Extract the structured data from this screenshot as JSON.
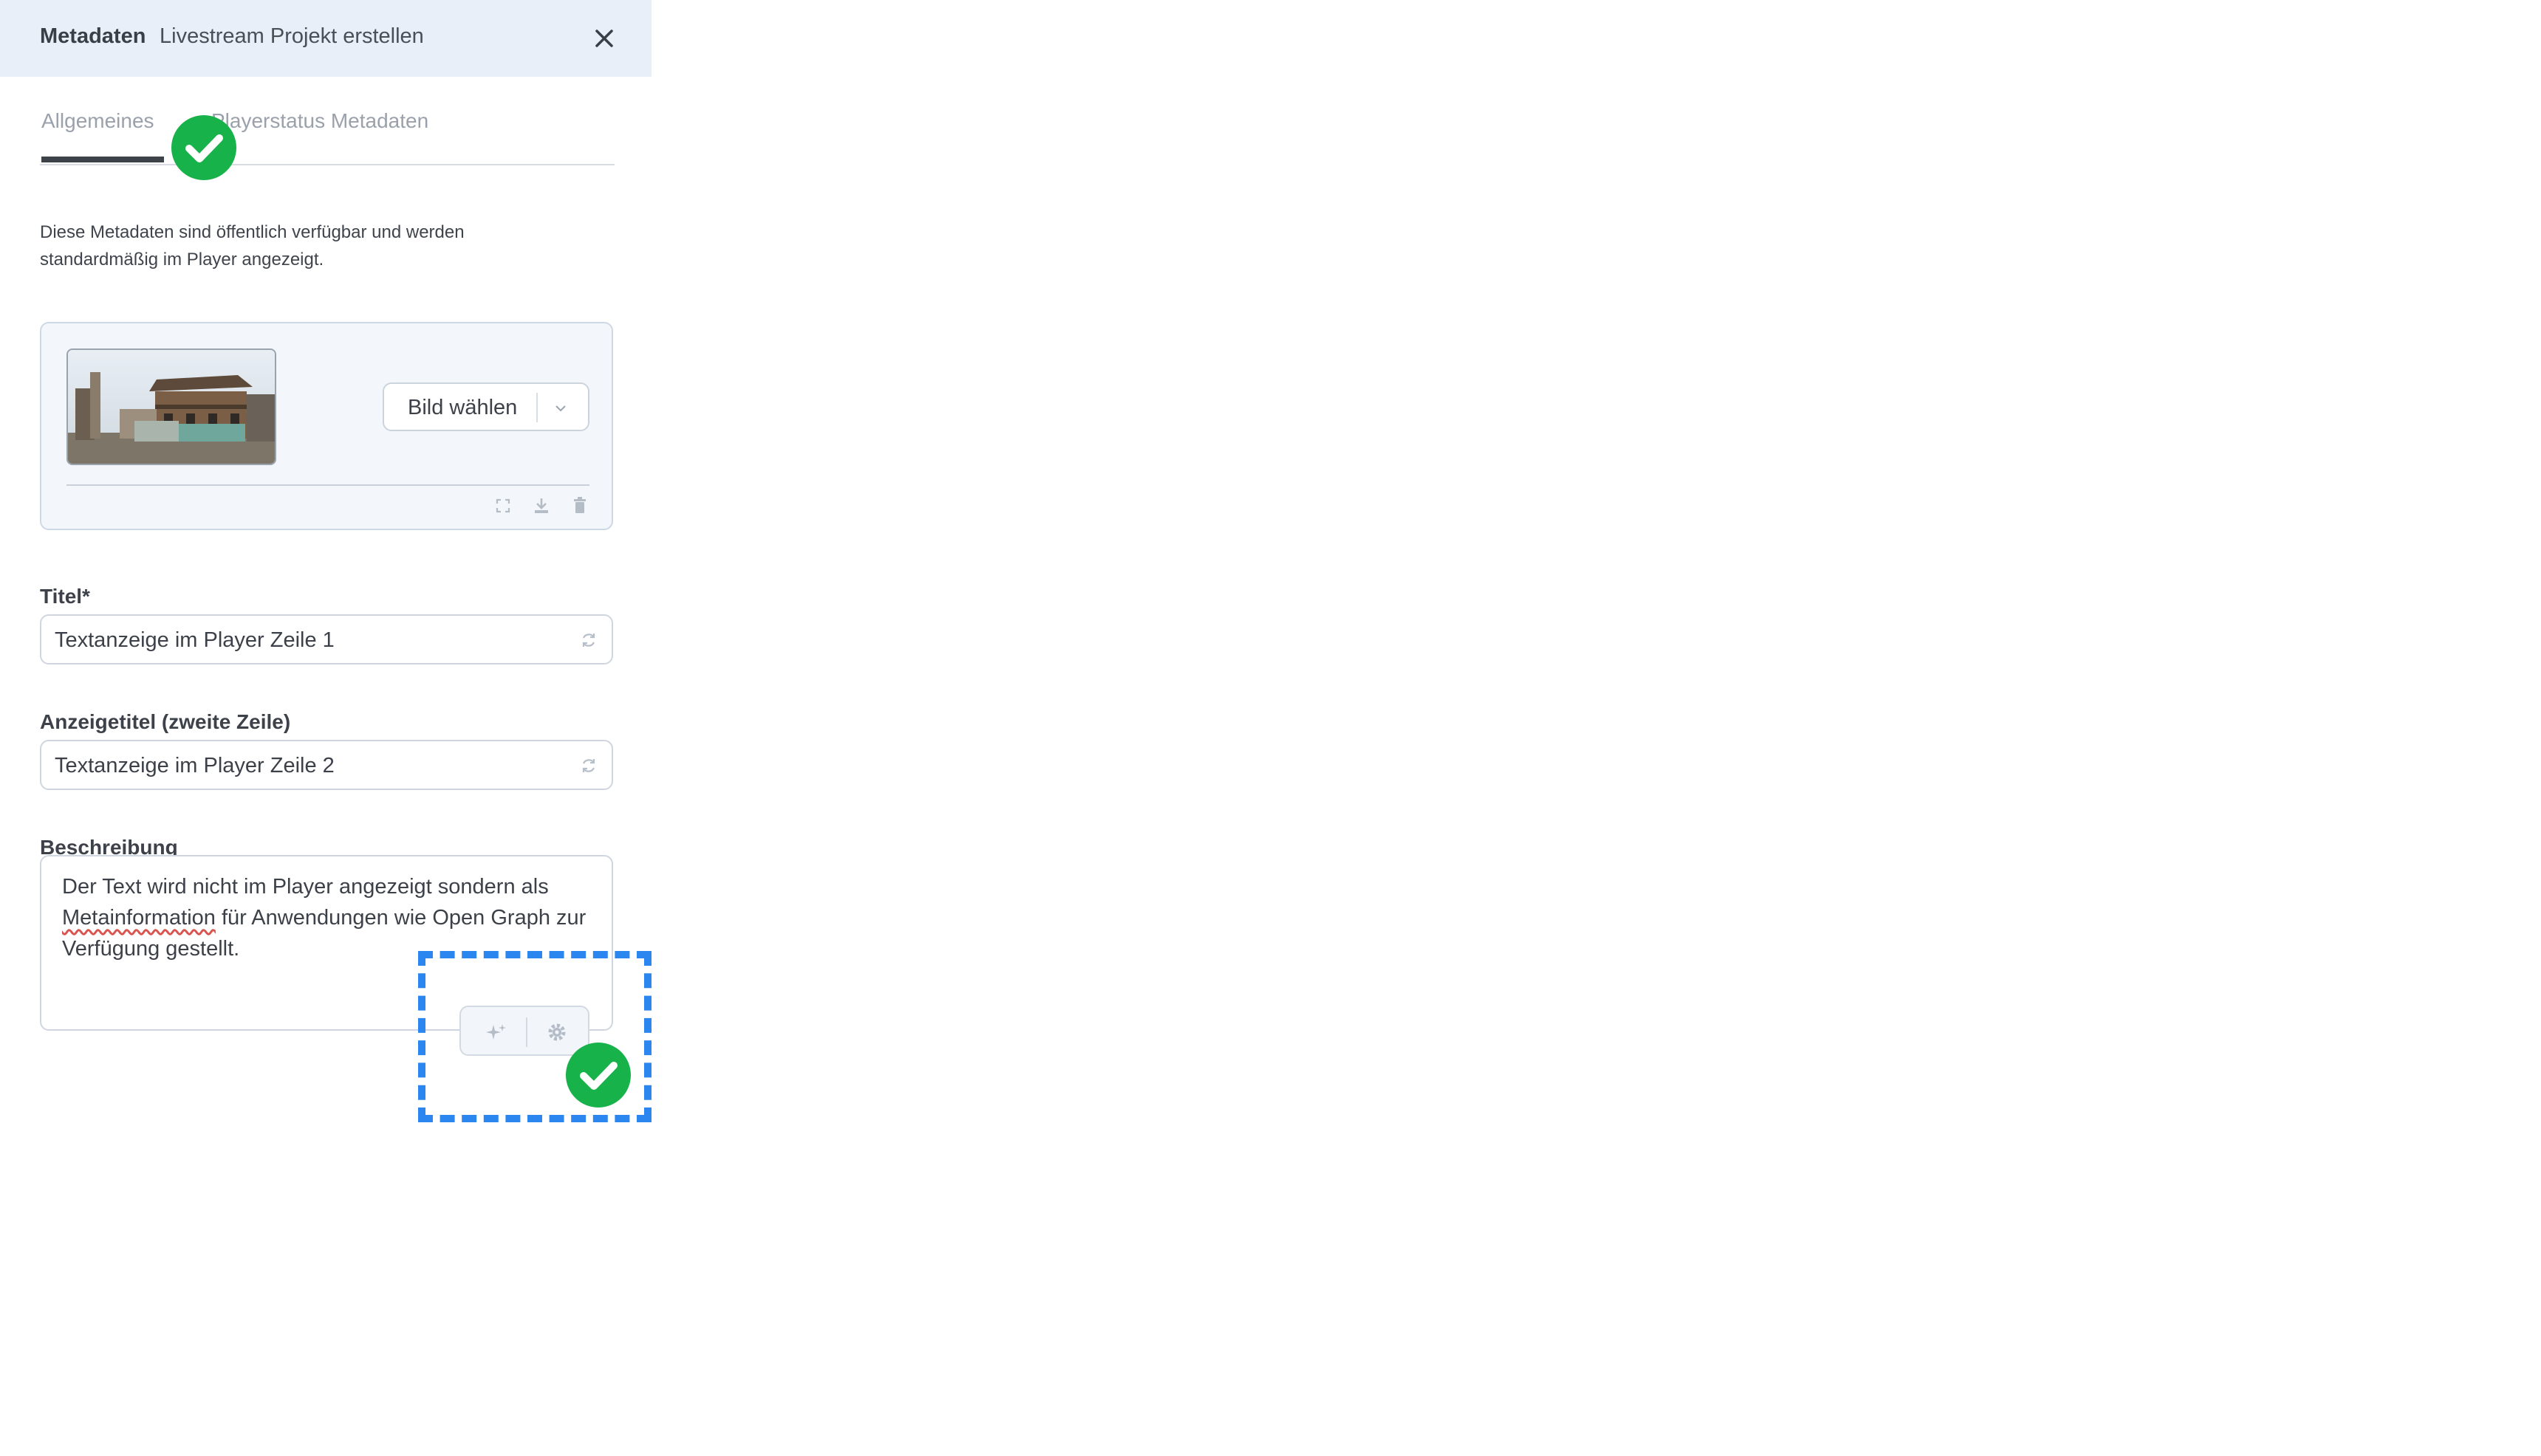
{
  "header": {
    "title": "Metadaten",
    "subtitle": "Livestream Projekt erstellen",
    "close_icon": "close-icon"
  },
  "tabs": [
    {
      "label": "Allgemeines",
      "active": true
    },
    {
      "label": "Playerstatus Metadaten",
      "active": false
    }
  ],
  "intro": "Diese Metadaten sind öffentlich verfügbar und werden standardmäßig im Player angezeigt.",
  "image": {
    "select_label": "Bild wählen",
    "icons": [
      "fullscreen-icon",
      "download-icon",
      "trash-icon"
    ]
  },
  "fields": {
    "title": {
      "label": "Titel*",
      "value": "Textanzeige im Player Zeile 1"
    },
    "display_title": {
      "label": "Anzeigetitel (zweite Zeile)",
      "value": "Textanzeige im Player Zeile 2"
    },
    "description": {
      "label": "Beschreibung",
      "value_part1": "Der Text wird nicht im Player angezeigt sondern als ",
      "value_misspelled": "Metainformation",
      "value_part2": " für Anwendungen wie Open Graph zur Verfügung gestellt."
    }
  },
  "toolbar": {
    "icons": [
      "sparkle-icon",
      "gear-icon"
    ]
  },
  "colors": {
    "accent": "#2b86f0",
    "success": "#18b24b",
    "header_bg": "#e9eff9"
  }
}
